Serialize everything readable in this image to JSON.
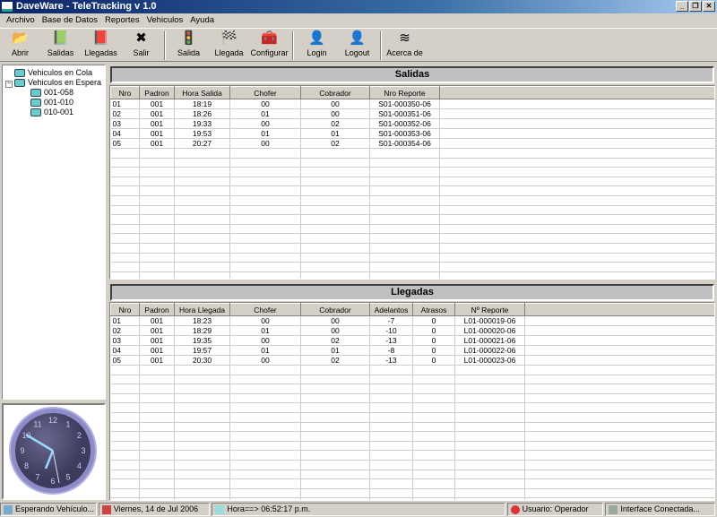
{
  "window": {
    "title": "DaveWare - TeleTracking v 1.0"
  },
  "menu": [
    "Archivo",
    "Base de Datos",
    "Reportes",
    "Vehiculos",
    "Ayuda"
  ],
  "toolbar": [
    {
      "label": "Abrir",
      "icon": "folder-open-icon",
      "glyph": "📂"
    },
    {
      "label": "Salidas",
      "icon": "book-green-icon",
      "glyph": "📗"
    },
    {
      "label": "Llegadas",
      "icon": "book-red-icon",
      "glyph": "📕"
    },
    {
      "label": "Salir",
      "icon": "exit-x-icon",
      "glyph": "✖"
    },
    {
      "label": "Salida",
      "icon": "traffic-light-icon",
      "glyph": "🚦"
    },
    {
      "label": "Llegada",
      "icon": "checkered-flag-icon",
      "glyph": "🏁"
    },
    {
      "label": "Configurar",
      "icon": "toolbox-icon",
      "glyph": "🧰"
    },
    {
      "label": "Login",
      "icon": "user-login-icon",
      "glyph": "👤"
    },
    {
      "label": "Logout",
      "icon": "user-logout-icon",
      "glyph": "👤"
    },
    {
      "label": "Acerca de",
      "icon": "about-logo-icon",
      "glyph": "≋"
    }
  ],
  "tree": {
    "root1": "Vehiculos en Cola",
    "root2": "Vehiculos en Espera",
    "children": [
      "001-058",
      "001-010",
      "010-001"
    ]
  },
  "salidas": {
    "title": "Salidas",
    "columns": [
      "Nro",
      "Padron",
      "Hora Salida",
      "Chofer",
      "Cobrador",
      "Nro Reporte"
    ],
    "rows": [
      [
        "01",
        "001",
        "18:19",
        "00",
        "00",
        "S01-000350-06"
      ],
      [
        "02",
        "001",
        "18:26",
        "01",
        "00",
        "S01-000351-06"
      ],
      [
        "03",
        "001",
        "19:33",
        "00",
        "02",
        "S01-000352-06"
      ],
      [
        "04",
        "001",
        "19:53",
        "01",
        "01",
        "S01-000353-06"
      ],
      [
        "05",
        "001",
        "20:27",
        "00",
        "02",
        "S01-000354-06"
      ]
    ]
  },
  "llegadas": {
    "title": "Llegadas",
    "columns": [
      "Nro",
      "Padron",
      "Hora Llegada",
      "Chofer",
      "Cobrador",
      "Adelantos",
      "Atrasos",
      "Nº Reporte"
    ],
    "rows": [
      [
        "01",
        "001",
        "18:23",
        "00",
        "00",
        "-7",
        "0",
        "L01-000019-06"
      ],
      [
        "02",
        "001",
        "18:29",
        "01",
        "00",
        "-10",
        "0",
        "L01-000020-06"
      ],
      [
        "03",
        "001",
        "19:35",
        "00",
        "02",
        "-13",
        "0",
        "L01-000021-06"
      ],
      [
        "04",
        "001",
        "19:57",
        "01",
        "01",
        "-8",
        "0",
        "L01-000022-06"
      ],
      [
        "05",
        "001",
        "20:30",
        "00",
        "02",
        "-13",
        "0",
        "L01-000023-06"
      ]
    ]
  },
  "clock": {
    "numbers": [
      "12",
      "1",
      "2",
      "3",
      "4",
      "5",
      "6",
      "7",
      "8",
      "9",
      "10",
      "11"
    ]
  },
  "status": {
    "state": "Esperando Vehículo...",
    "date": "Viernes, 14 de Jul 2006",
    "time": "Hora==> 06:52:17 p.m.",
    "user": "Usuario: Operador",
    "iface": "Interface Conectada..."
  }
}
